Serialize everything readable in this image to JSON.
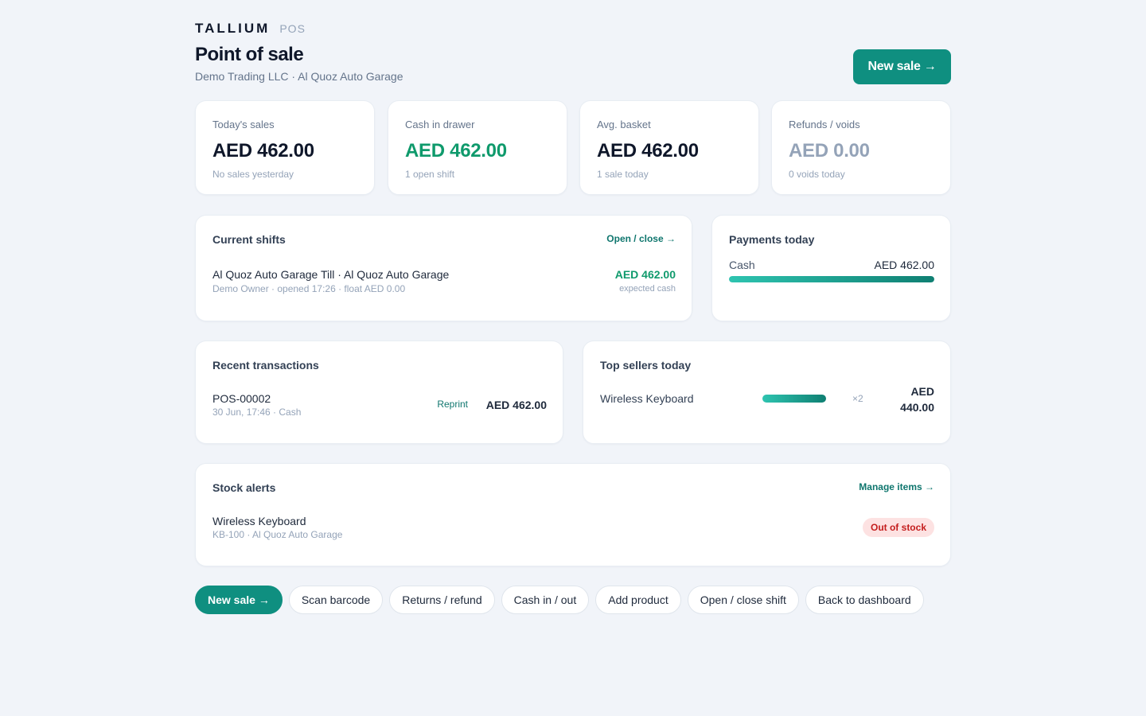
{
  "brand": {
    "name": "TALLIUM",
    "tag": "POS"
  },
  "header": {
    "title": "Point of sale",
    "subtitle": "Demo Trading LLC · Al Quoz Auto Garage",
    "new_sale_label": "New sale →"
  },
  "stats": [
    {
      "label": "Today's sales",
      "value": "AED 462.00",
      "note": "No sales yesterday"
    },
    {
      "label": "Cash in drawer",
      "value": "AED 462.00",
      "note": "1 open shift"
    },
    {
      "label": "Avg. basket",
      "value": "AED 462.00",
      "note": "1 sale today"
    },
    {
      "label": "Refunds / voids",
      "value": "AED 0.00",
      "note": "0 voids today"
    }
  ],
  "shifts": {
    "title": "Current shifts",
    "link": "Open / close →",
    "items": [
      {
        "name": "Al Quoz Auto Garage Till · Al Quoz Auto Garage",
        "meta": "Demo Owner · opened 17:26 · float AED 0.00",
        "amount": "AED 462.00",
        "amount_note": "expected cash"
      }
    ]
  },
  "payments": {
    "title": "Payments today",
    "items": [
      {
        "method": "Cash",
        "amount": "AED 462.00",
        "share": 1.0
      }
    ]
  },
  "transactions": {
    "title": "Recent transactions",
    "items": [
      {
        "id": "POS-00002",
        "meta": "30 Jun, 17:46 · Cash",
        "action": "Reprint",
        "amount": "AED 462.00"
      }
    ]
  },
  "top_sellers": {
    "title": "Top sellers today",
    "items": [
      {
        "name": "Wireless Keyboard",
        "qty": "×2",
        "amount": "AED 440.00",
        "share": 1.0
      }
    ]
  },
  "stock": {
    "title": "Stock alerts",
    "link": "Manage items →",
    "items": [
      {
        "name": "Wireless Keyboard",
        "meta": "KB-100 · Al Quoz Auto Garage",
        "status": "Out of stock"
      }
    ]
  },
  "actions": [
    "New sale →",
    "Scan barcode",
    "Returns / refund",
    "Cash in / out",
    "Add product",
    "Open / close shift",
    "Back to dashboard"
  ],
  "colors": {
    "accent": "#0f8f80",
    "positive": "#0f9a6c",
    "danger": "#c41d1d",
    "background": "#f1f4f9"
  }
}
